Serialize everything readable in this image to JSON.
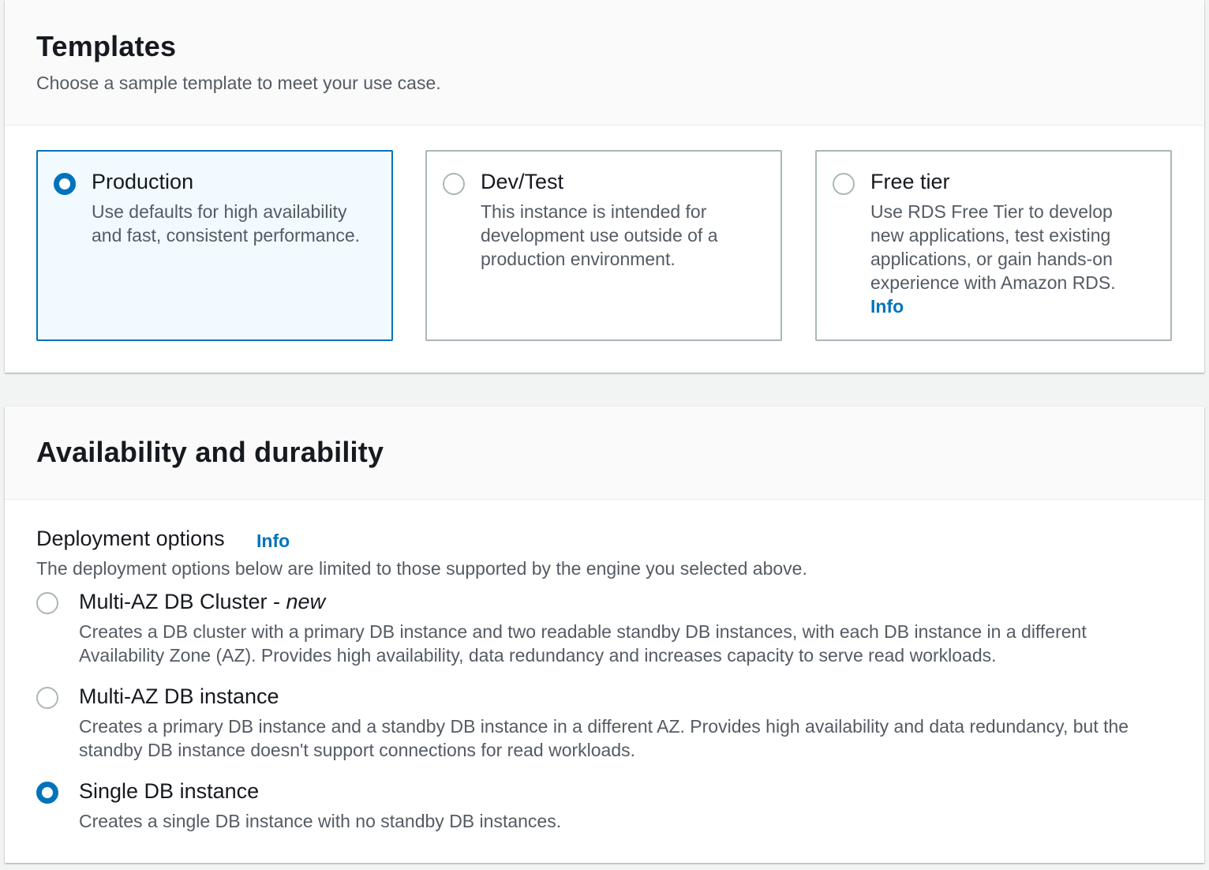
{
  "templates": {
    "title": "Templates",
    "description": "Choose a sample template to meet your use case.",
    "options": [
      {
        "title": "Production",
        "description": "Use defaults for high availability and fast, consistent performance.",
        "selected": true
      },
      {
        "title": "Dev/Test",
        "description": "This instance is intended for development use outside of a production environment.",
        "selected": false
      },
      {
        "title": "Free tier",
        "description": "Use RDS Free Tier to develop new applications, test existing applications, or gain hands-on experience with Amazon RDS.",
        "info_label": "Info",
        "selected": false
      }
    ]
  },
  "availability": {
    "title": "Availability and durability",
    "deployment_label": "Deployment options",
    "info_label": "Info",
    "deployment_description": "The deployment options below are limited to those supported by the engine you selected above.",
    "options": [
      {
        "title": "Multi-AZ DB Cluster - ",
        "title_emphasis": "new",
        "description": "Creates a DB cluster with a primary DB instance and two readable standby DB instances, with each DB instance in a different Availability Zone (AZ). Provides high availability, data redundancy and increases capacity to serve read workloads.",
        "selected": false
      },
      {
        "title": "Multi-AZ DB instance",
        "description": "Creates a primary DB instance and a standby DB instance in a different AZ. Provides high availability and data redundancy, but the standby DB instance doesn't support connections for read workloads.",
        "selected": false
      },
      {
        "title": "Single DB instance",
        "description": "Creates a single DB instance with no standby DB instances.",
        "selected": true
      }
    ]
  },
  "colors": {
    "accent": "#0073bb",
    "text": "#16191f",
    "secondary_text": "#545b64",
    "border": "#aab7b8",
    "selected_tile_background": "#f1faff"
  }
}
